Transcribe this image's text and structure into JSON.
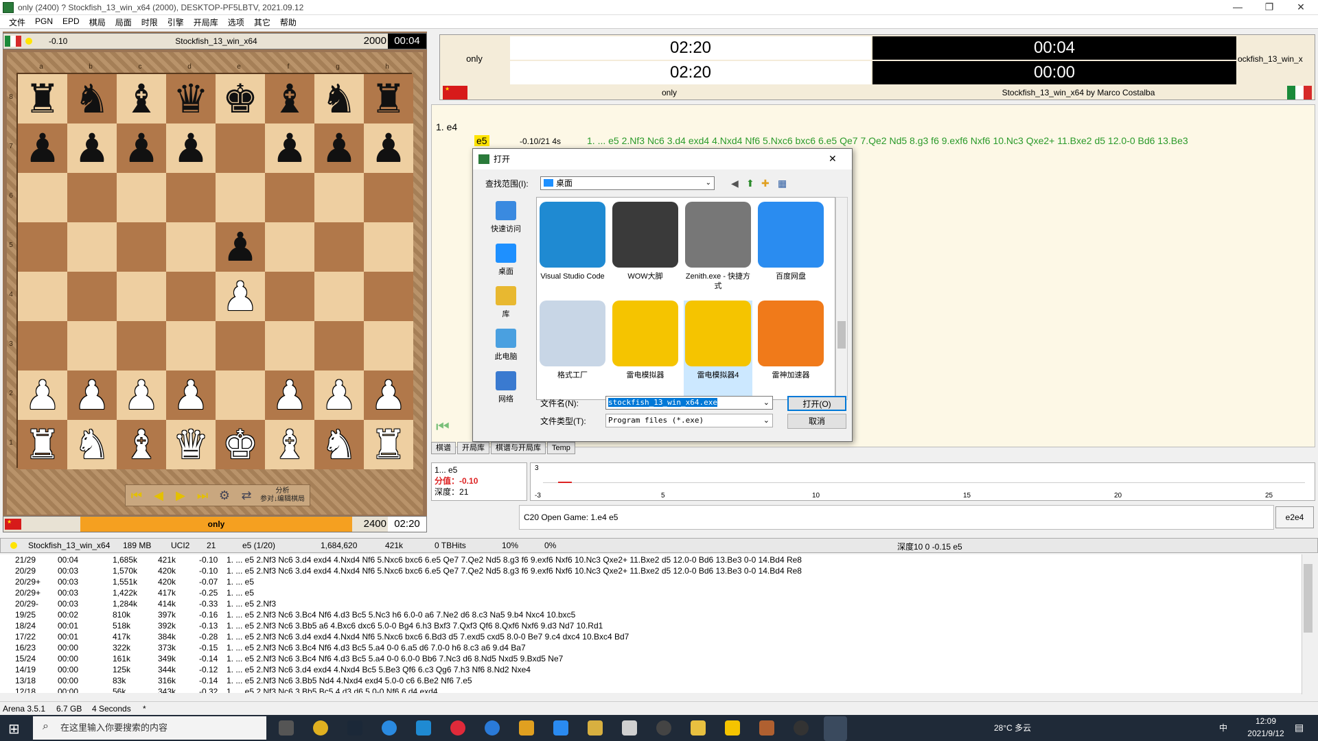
{
  "window": {
    "title": "only (2400)  ? Stockfish_13_win_x64 (2000),   DESKTOP-PF5LBTV,   2021.09.12",
    "min": "—",
    "max": "❐",
    "close": "✕"
  },
  "menu": [
    "文件",
    "PGN",
    "EPD",
    "棋局",
    "局面",
    "时限",
    "引擎",
    "开局库",
    "选项",
    "其它",
    "帮助"
  ],
  "top_player": {
    "eval": "-0.10",
    "name": "Stockfish_13_win_x64",
    "rating": "2000",
    "clock": "00:04"
  },
  "bottom_player": {
    "name": "only",
    "rating": "2400",
    "clock": "02:20"
  },
  "board": {
    "files": [
      "a",
      "b",
      "c",
      "d",
      "e",
      "f",
      "g",
      "h"
    ],
    "ranks": [
      "8",
      "7",
      "6",
      "5",
      "4",
      "3",
      "2",
      "1"
    ],
    "rows": [
      [
        "bR",
        "bN",
        "bB",
        "bQ",
        "bK",
        "bB",
        "bN",
        "bR"
      ],
      [
        "bP",
        "bP",
        "bP",
        "bP",
        "",
        "bP",
        "bP",
        "bP"
      ],
      [
        "",
        "",
        "",
        "",
        "",
        "",
        "",
        ""
      ],
      [
        "",
        "",
        "",
        "",
        "bP",
        "",
        "",
        ""
      ],
      [
        "",
        "",
        "",
        "",
        "wP",
        "",
        "",
        ""
      ],
      [
        "",
        "",
        "",
        "",
        "",
        "",
        "",
        ""
      ],
      [
        "wP",
        "wP",
        "wP",
        "wP",
        "",
        "wP",
        "wP",
        "wP"
      ],
      [
        "wR",
        "wN",
        "wB",
        "wQ",
        "wK",
        "wB",
        "wN",
        "wR"
      ]
    ]
  },
  "nav": {
    "first": "⏮",
    "prev": "◀",
    "next": "▶",
    "last": "⏭",
    "gear": "⚙",
    "flip": "⇄",
    "text": "分析\n参对↓编辑棋局"
  },
  "clocks": {
    "white_name": "only",
    "white_time1": "02:20",
    "white_time2": "02:20",
    "black_time1": "00:04",
    "black_time2": "00:00",
    "black_name_short": "ockfish_13_win_x",
    "white_label": "only",
    "black_label": "Stockfish_13_win_x64 by Marco Costalba"
  },
  "notation": {
    "move1": "1. e4",
    "move1b": "e5",
    "eval": "-0.10/21 4s",
    "pv": "1. ... e5 2.Nf3 Nc6 3.d4 exd4 4.Nxd4 Nf6 5.Nxc6 bxc6 6.e5 Qe7 7.Qe2 Nd5 8.g3 f6 9.exf6 Nxf6 10.Nc3 Qxe2+ 11.Bxe2 d5 12.0-0 Bd6 13.Be3"
  },
  "tabs": [
    "棋谱",
    "开局库",
    "棋谱与开局库",
    "Temp"
  ],
  "evalbox": {
    "move": "1... e5",
    "score_label": "分值：",
    "score": "-0.10",
    "depth_label": "深度：",
    "depth": "21"
  },
  "graph": {
    "top": "3",
    "bottom": "-3",
    "ticks": [
      "5",
      "10",
      "15",
      "20",
      "25"
    ]
  },
  "opening": {
    "text": "C20  Open Game: 1.e4 e5",
    "move": "e2e4"
  },
  "engine_header": {
    "name": "Stockfish_13_win_x64",
    "hash": "189 MB",
    "proto": "UCI2",
    "depth": "21",
    "move": "e5 (1/20)",
    "nodes": "1,684,620",
    "nps": "421k",
    "tb": "0 TBHits",
    "cpu": "10%",
    "hashfull": "0%",
    "summary": "深度10  0  -0.15   e5"
  },
  "lines": [
    [
      "21/29",
      "00:04",
      "1,685k",
      "421k",
      "-0.10",
      "1. ... e5 2.Nf3 Nc6 3.d4 exd4 4.Nxd4 Nf6 5.Nxc6 bxc6 6.e5 Qe7 7.Qe2 Nd5 8.g3 f6 9.exf6 Nxf6 10.Nc3 Qxe2+ 11.Bxe2 d5 12.0-0 Bd6 13.Be3 0-0 14.Bd4 Re8"
    ],
    [
      "20/29",
      "00:03",
      "1,570k",
      "420k",
      "-0.10",
      "1. ... e5 2.Nf3 Nc6 3.d4 exd4 4.Nxd4 Nf6 5.Nxc6 bxc6 6.e5 Qe7 7.Qe2 Nd5 8.g3 f6 9.exf6 Nxf6 10.Nc3 Qxe2+ 11.Bxe2 d5 12.0-0 Bd6 13.Be3 0-0 14.Bd4 Re8"
    ],
    [
      "20/29+",
      "00:03",
      "1,551k",
      "420k",
      "-0.07",
      "1. ... e5"
    ],
    [
      "20/29+",
      "00:03",
      "1,422k",
      "417k",
      "-0.25",
      "1. ... e5"
    ],
    [
      "20/29-",
      "00:03",
      "1,284k",
      "414k",
      "-0.33",
      "1. ... e5 2.Nf3"
    ],
    [
      "19/25",
      "00:02",
      "810k",
      "397k",
      "-0.16",
      "1. ... e5 2.Nf3 Nc6 3.Bc4 Nf6 4.d3 Bc5 5.Nc3 h6 6.0-0 a6 7.Ne2 d6 8.c3 Na5 9.b4 Nxc4 10.bxc5"
    ],
    [
      "18/24",
      "00:01",
      "518k",
      "392k",
      "-0.13",
      "1. ... e5 2.Nf3 Nc6 3.Bb5 a6 4.Bxc6 dxc6 5.0-0 Bg4 6.h3 Bxf3 7.Qxf3 Qf6 8.Qxf6 Nxf6 9.d3 Nd7 10.Rd1"
    ],
    [
      "17/22",
      "00:01",
      "417k",
      "384k",
      "-0.28",
      "1. ... e5 2.Nf3 Nc6 3.d4 exd4 4.Nxd4 Nf6 5.Nxc6 bxc6 6.Bd3 d5 7.exd5 cxd5 8.0-0 Be7 9.c4 dxc4 10.Bxc4 Bd7"
    ],
    [
      "16/23",
      "00:00",
      "322k",
      "373k",
      "-0.15",
      "1. ... e5 2.Nf3 Nc6 3.Bc4 Nf6 4.d3 Bc5 5.a4 0-0 6.a5 d6 7.0-0 h6 8.c3 a6 9.d4 Ba7"
    ],
    [
      "15/24",
      "00:00",
      "161k",
      "349k",
      "-0.14",
      "1. ... e5 2.Nf3 Nc6 3.Bc4 Nf6 4.d3 Bc5 5.a4 0-0 6.0-0 Bb6 7.Nc3 d6 8.Nd5 Nxd5 9.Bxd5 Ne7"
    ],
    [
      "14/19",
      "00:00",
      "125k",
      "344k",
      "-0.12",
      "1. ... e5 2.Nf3 Nc6 3.d4 exd4 4.Nxd4 Bc5 5.Be3 Qf6 6.c3 Qg6 7.h3 Nf6 8.Nd2 Nxe4"
    ],
    [
      "13/18",
      "00:00",
      "83k",
      "316k",
      "-0.14",
      "1. ... e5 2.Nf3 Nc6 3.Bb5 Nd4 4.Nxd4 exd4 5.0-0 c6 6.Be2 Nf6 7.e5"
    ],
    [
      "12/18",
      "00:00",
      "56k",
      "343k",
      "-0.32",
      "1. ... e5 2.Nf3 Nc6 3.Bb5 Bc5 4.d3 d6 5.0-0 Nf6 6.d4 exd4"
    ]
  ],
  "status": {
    "app": "Arena 3.5.1",
    "mem": "6.7 GB",
    "time": "4 Seconds",
    "flag": "*"
  },
  "dialog": {
    "title": "打开",
    "close": "✕",
    "lookin_label": "查找范围(I):",
    "lookin": "桌面",
    "places": [
      "快速访问",
      "桌面",
      "库",
      "此电脑",
      "网络"
    ],
    "files": [
      {
        "name": "Visual Studio Code",
        "color": "#1f8ad2"
      },
      {
        "name": "WOW大脚",
        "color": "#3a3a3a"
      },
      {
        "name": "Zenith.exe - 快捷方式",
        "color": "#777777"
      },
      {
        "name": "百度网盘",
        "color": "#2a8cf0"
      },
      {
        "name": "格式工厂",
        "color": "#c8d6e6"
      },
      {
        "name": "雷电模拟器",
        "color": "#f5c400"
      },
      {
        "name": "雷电模拟器4",
        "color": "#f5c400"
      },
      {
        "name": "雷神加速器",
        "color": "#f07a1a"
      }
    ],
    "filename_label": "文件名(N):",
    "filename": "stockfish_13_win_x64.exe",
    "filetype_label": "文件类型(T):",
    "filetype": "Program files (*.exe)",
    "open": "打开(O)",
    "cancel": "取消"
  },
  "taskbar": {
    "search": "在这里输入你要搜索的内容",
    "weather": "28°C  多云",
    "time": "12:09",
    "date": "2021/9/12",
    "ime": "中"
  }
}
